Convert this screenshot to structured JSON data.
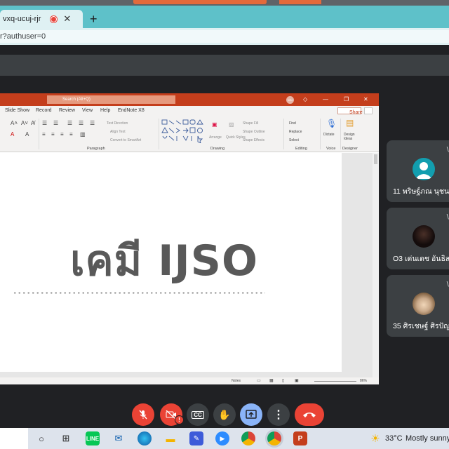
{
  "browser": {
    "tab_title": "vxq-ucuj-rjr",
    "tab_close": "✕",
    "new_tab": "+",
    "address": "r?authuser=0"
  },
  "powerpoint": {
    "search_placeholder": "Search (Alt+Q)",
    "user_short": "WN",
    "menu": [
      "Slide Show",
      "Record",
      "Review",
      "View",
      "Help",
      "EndNote X8"
    ],
    "share_label": "Share",
    "ribbon": {
      "text_direction": "Text Direction",
      "align_text": "Align Text",
      "convert_smartart": "Convert to SmartArt",
      "arrange": "Arrange",
      "quick_styles": "Quick Styles",
      "shape_fill": "Shape Fill",
      "shape_outline": "Shape Outline",
      "shape_effects": "Shape Effects",
      "find": "Find",
      "replace": "Replace",
      "select": "Select",
      "dictate": "Dictate",
      "design_ideas": "Design Ideas",
      "groups": {
        "paragraph": "Paragraph",
        "drawing": "Drawing",
        "editing": "Editing",
        "voice": "Voice",
        "designer": "Designer"
      }
    },
    "slide_title": "เคมี IJSO",
    "status": {
      "notes": "Notes",
      "zoom": "86%"
    }
  },
  "participants": [
    {
      "name": "11 พริษฐ์ภณ นุชนา",
      "avatar": "teal-person"
    },
    {
      "name": "O3 เด่นเดช อันธิสา",
      "avatar": "dark-photo"
    },
    {
      "name": "35 ศิรเชษฐ์ ศิรปัญ",
      "avatar": "anime-photo"
    }
  ],
  "controls": {
    "mic": "mic-off",
    "camera": "camera-off",
    "camera_warning": "!",
    "captions": "CC",
    "hand": "raise-hand",
    "present": "present-screen",
    "more": "more-options",
    "end": "end-call"
  },
  "taskbar": {
    "weather_temp": "33°C",
    "weather_desc": "Mostly sunny"
  }
}
